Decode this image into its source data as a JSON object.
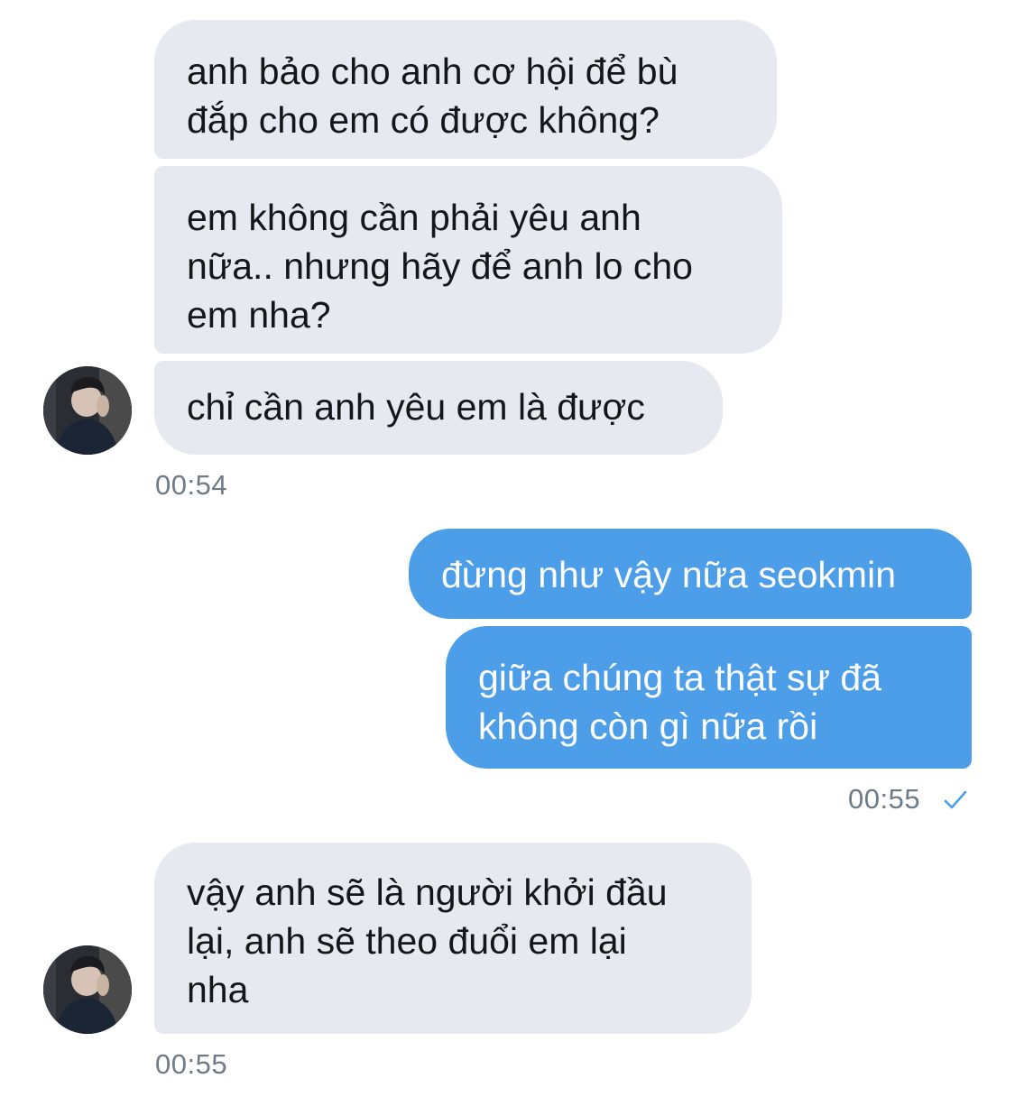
{
  "conversation": {
    "messages": [
      {
        "sender": "other",
        "text": "anh bảo cho anh cơ hội để bù\nđắp cho em có được không?"
      },
      {
        "sender": "other",
        "text": "em không cần phải yêu anh\nnữa.. nhưng hãy để anh lo cho\nem nha?"
      },
      {
        "sender": "other",
        "text": "chỉ cần anh yêu em là được"
      },
      {
        "sender": "me",
        "text": "đừng như vậy nữa seokmin"
      },
      {
        "sender": "me",
        "text": "giữa chúng ta thật sự đã\nkhông còn gì nữa rồi"
      },
      {
        "sender": "other",
        "text": "vậy anh sẽ là người khởi đầu\nlại, anh sẽ theo đuổi em lại\nnha"
      }
    ],
    "timestamps": [
      "00:54",
      "00:55",
      "00:55"
    ],
    "read_status_icon": "checkmark-icon"
  },
  "colors": {
    "received_bubble": "#e6e9f0",
    "sent_bubble": "#4d9ee9",
    "timestamp": "#6e7b88"
  }
}
